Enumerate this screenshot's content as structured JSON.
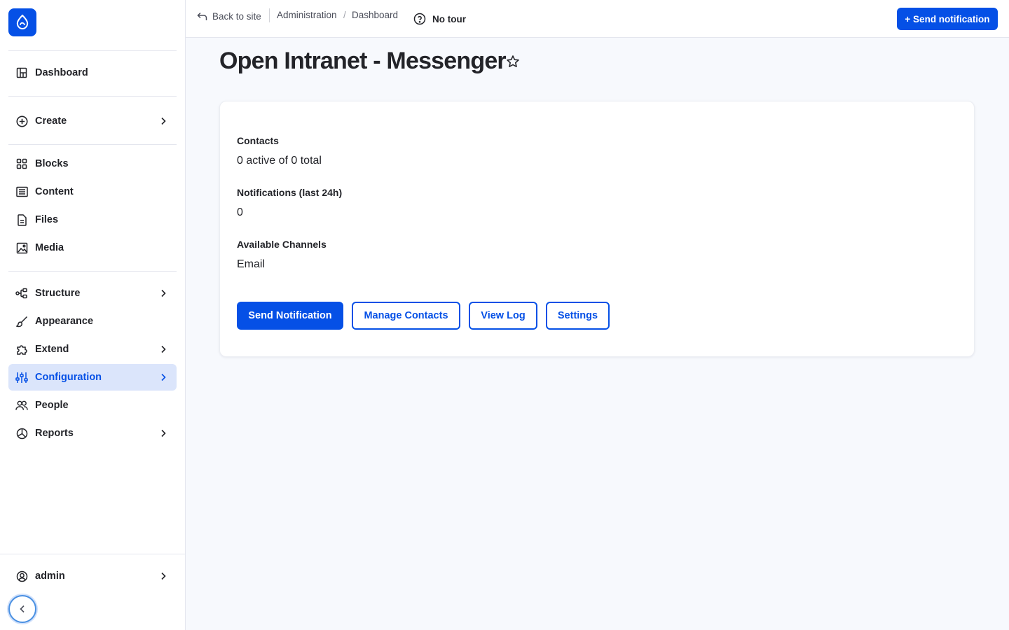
{
  "sidebar": {
    "logo_icon": "drupal-drop-icon",
    "items": [
      {
        "label": "Dashboard",
        "icon": "dashboard-icon"
      },
      {
        "label": "Create",
        "icon": "plus-circle-icon"
      },
      {
        "label": "Blocks",
        "icon": "blocks-icon"
      },
      {
        "label": "Content",
        "icon": "content-icon"
      },
      {
        "label": "Files",
        "icon": "files-icon"
      },
      {
        "label": "Media",
        "icon": "media-icon"
      },
      {
        "label": "Structure",
        "icon": "structure-icon"
      },
      {
        "label": "Appearance",
        "icon": "brush-icon"
      },
      {
        "label": "Extend",
        "icon": "puzzle-icon"
      },
      {
        "label": "Configuration",
        "icon": "sliders-icon",
        "active": true
      },
      {
        "label": "People",
        "icon": "people-icon"
      },
      {
        "label": "Reports",
        "icon": "reports-icon"
      }
    ],
    "user": {
      "label": "admin",
      "icon": "user-circle-icon"
    },
    "collapse_icon": "chevron-left-icon"
  },
  "topbar": {
    "back_label": "Back to site",
    "breadcrumb": [
      "Administration",
      "Dashboard"
    ],
    "tour_label": "No tour",
    "action_label": "+ Send notification"
  },
  "page": {
    "title": "Open Intranet - Messenger"
  },
  "card": {
    "contacts_label": "Contacts",
    "contacts_value": "0 active of 0 total",
    "notifications_label": "Notifications (last 24h)",
    "notifications_value": "0",
    "channels_label": "Available Channels",
    "channels_value": "Email",
    "buttons": {
      "send": "Send Notification",
      "manage": "Manage Contacts",
      "log": "View Log",
      "settings": "Settings"
    }
  },
  "colors": {
    "accent": "#0550e6",
    "active_bg": "#dbe5fb",
    "background": "#f7f9fd"
  }
}
